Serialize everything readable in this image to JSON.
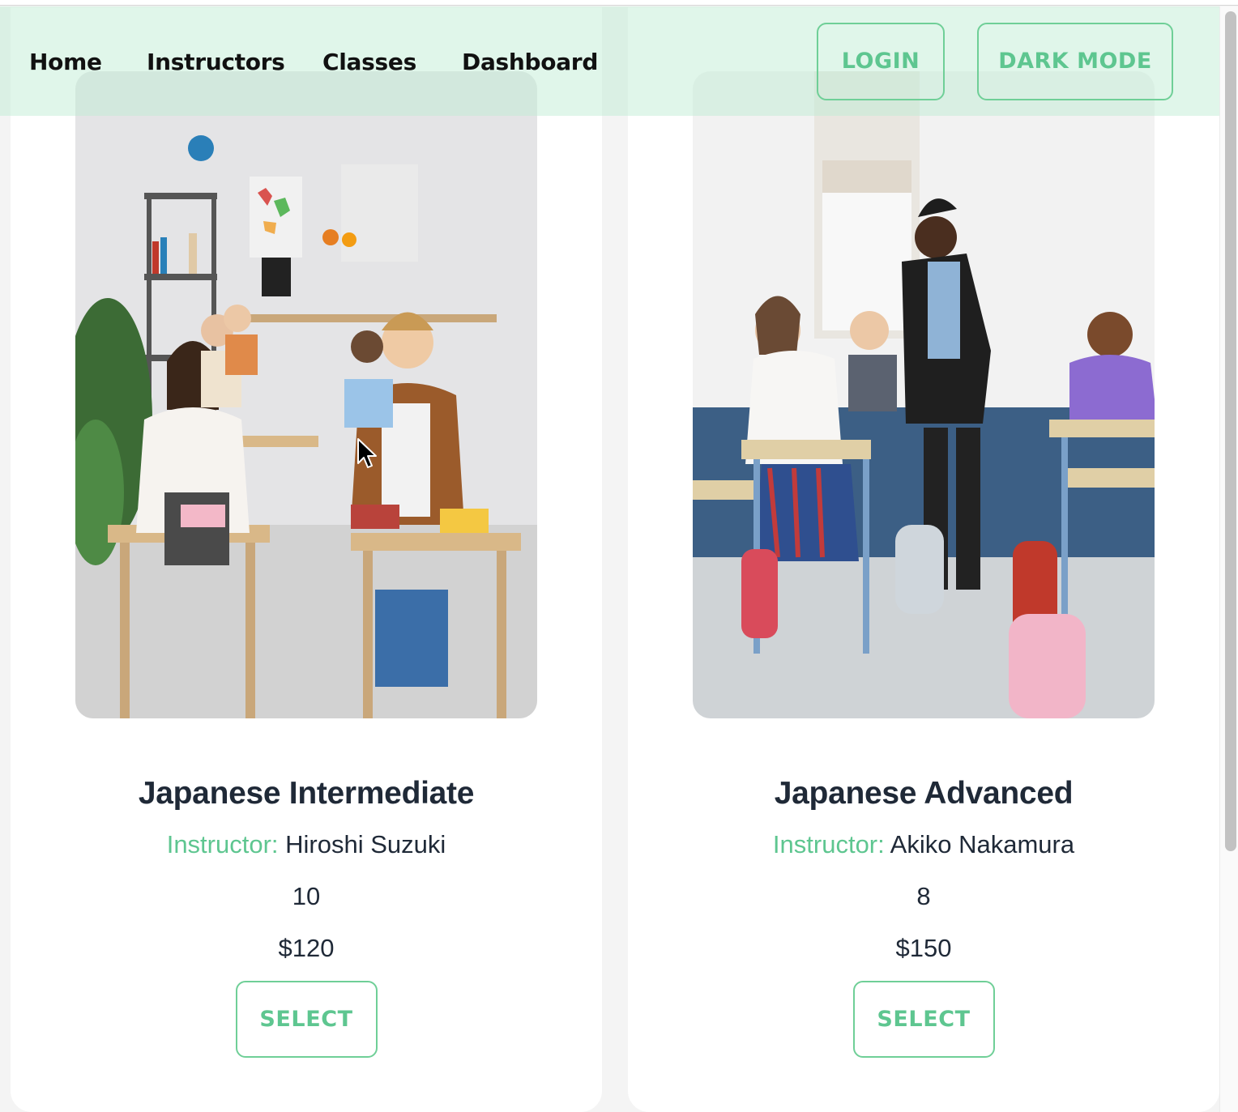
{
  "nav": {
    "links": [
      "Home",
      "Instructors",
      "Classes",
      "Dashboard"
    ],
    "login_label": "LOGIN",
    "dark_mode_label": "DARK MODE"
  },
  "classes": [
    {
      "title": "Japanese Intermediate",
      "instructor_label": "Instructor:",
      "instructor_name": "Hiroshi Suzuki",
      "seats": "10",
      "price": "$120",
      "button_label": "SELECT",
      "image": "classroom-students-seated-photo"
    },
    {
      "title": "Japanese Advanced",
      "instructor_label": "Instructor:",
      "instructor_name": "Akiko Nakamura",
      "seats": "8",
      "price": "$150",
      "button_label": "SELECT",
      "image": "teacher-helping-students-photo"
    }
  ],
  "colors": {
    "accent": "#5ec690",
    "navbar_bg": "#d6f3e4",
    "text_dark": "#1f2937"
  }
}
